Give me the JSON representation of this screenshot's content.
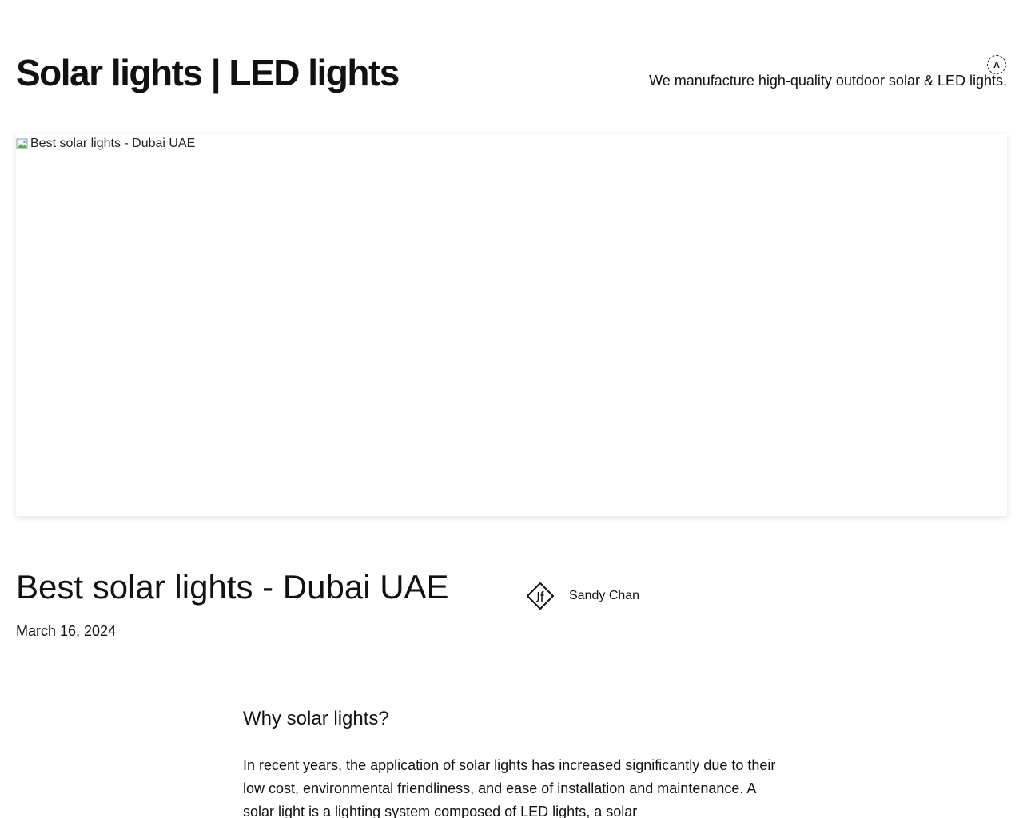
{
  "header": {
    "site_title": "Solar lights | LED lights",
    "tagline": "We manufacture high-quality outdoor solar & LED lights.",
    "a11y_toggle_label": "A"
  },
  "hero": {
    "image_alt": "Best solar lights - Dubai UAE"
  },
  "post": {
    "title": "Best solar lights - Dubai UAE",
    "date": "March 16, 2024",
    "author": "Sandy Chan"
  },
  "content": {
    "heading": "Why solar lights?",
    "paragraph": "In recent years, the application of solar lights has increased significantly due to their low cost, environmental friendliness, and ease of installation and maintenance. A solar light is a lighting system composed of LED lights, a solar"
  },
  "icons": {
    "broken_image": "broken-image-icon",
    "author_avatar": "jf-logo-icon",
    "a11y": "accessibility-toggle"
  }
}
